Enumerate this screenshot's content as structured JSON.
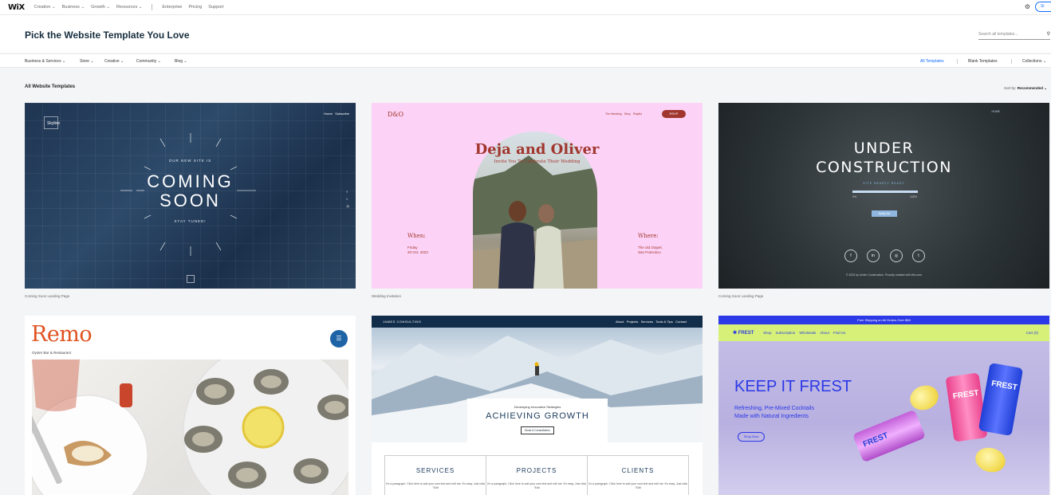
{
  "topnav": {
    "logo": "WiX",
    "items": [
      "Creation ⌄",
      "Business ⌄",
      "Growth ⌄",
      "Resources ⌄",
      "Enterprise",
      "Pricing",
      "Support"
    ],
    "signin": "Si"
  },
  "header": {
    "title": "Pick the Website Template You Love",
    "search_placeholder": "Search all templates..."
  },
  "categories": {
    "left": [
      "Business & Services ⌄",
      "Store ⌄",
      "Creative ⌄",
      "Community ⌄",
      "Blog ⌄"
    ],
    "right": [
      "All Templates",
      "Blank Templates",
      "Collections ⌄"
    ]
  },
  "section": {
    "title": "All Website Templates",
    "sort_label": "Sort by:",
    "sort_value": "Recommended ⌄"
  },
  "templates": [
    {
      "caption": "Coming Soon Landing Page",
      "brand": "Skyline",
      "links": [
        "Home",
        "Subscribe"
      ],
      "line1": "OUR NEW SITE IS",
      "big1": "COMING",
      "big2": "SOON",
      "line2": "STAY TUNED!",
      "social": [
        "f",
        "t",
        "◎"
      ]
    },
    {
      "caption": "Wedding Invitation",
      "mono": "D&O",
      "nav": [
        "The Wedding",
        "Story",
        "Playlist"
      ],
      "rsvp": "RSVP",
      "names": "Deja and Oliver",
      "sub": "Invite You To Celebrate Their Wedding",
      "when_label": "When:",
      "when_detail": [
        "Friday",
        "20 Oct. 2023"
      ],
      "where_label": "Where:",
      "where_detail": [
        "The old chapel,",
        "San Francisco"
      ]
    },
    {
      "caption": "Coming Soon Landing Page",
      "home": "HOME",
      "big1": "UNDER",
      "big2": "CONSTRUCTION",
      "ready": "SITE NEARLY READY",
      "progress_start": "0%",
      "progress_end": "100%",
      "progress_value": 1.0,
      "notify": "Notify Me",
      "social": [
        "f",
        "in",
        "◎",
        "t"
      ],
      "foot": "© 2023 by Under Construction. Proudly created with Wix.com"
    },
    {
      "name": "Remo",
      "sub": "Oyster Bar & Restaurant"
    },
    {
      "brand": "JAMES CONSULTING",
      "nav": [
        "About",
        "Projects",
        "Services",
        "Tools & Tips",
        "Contact"
      ],
      "panel_sub": "Developing Innovative Strategies",
      "panel_title": "ACHIEVING GROWTH",
      "panel_button": "Book A Consultation",
      "cols": [
        "SERVICES",
        "PROJECTS",
        "CLIENTS"
      ],
      "col_text": "I'm a paragraph. Click here to add your own text and edit me. It's easy. Just click \"Edit"
    },
    {
      "strip": "Free Shipping on All Orders Over $50",
      "brand": "✱ FREST",
      "nav": [
        "Shop",
        "Subscription",
        "Wholesale",
        "About",
        "Find Us"
      ],
      "cart": "Cart (0)",
      "title": "KEEP IT FREST",
      "p1": "Refreshing, Pre-Mixed Cocktails",
      "p2": "Made with Natural Ingredients",
      "shop": "Shop Now",
      "can1": "FREST",
      "can2": "FREST",
      "can3": "FREST"
    }
  ]
}
